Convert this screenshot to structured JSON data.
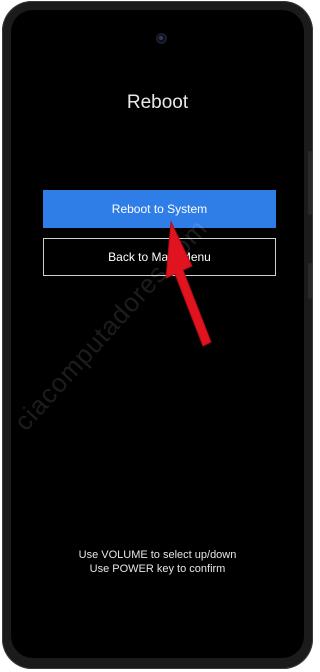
{
  "screen": {
    "title": "Reboot",
    "menu": [
      {
        "label": "Reboot to System",
        "selected": true
      },
      {
        "label": "Back to Main Menu",
        "selected": false
      }
    ],
    "instructions": [
      "Use VOLUME to select up/down",
      "Use POWER key to confirm"
    ]
  },
  "watermark": "ciacomputadores.com",
  "colors": {
    "background": "#000000",
    "selected_button": "#2f7ee8",
    "arrow": "#e0131f"
  }
}
